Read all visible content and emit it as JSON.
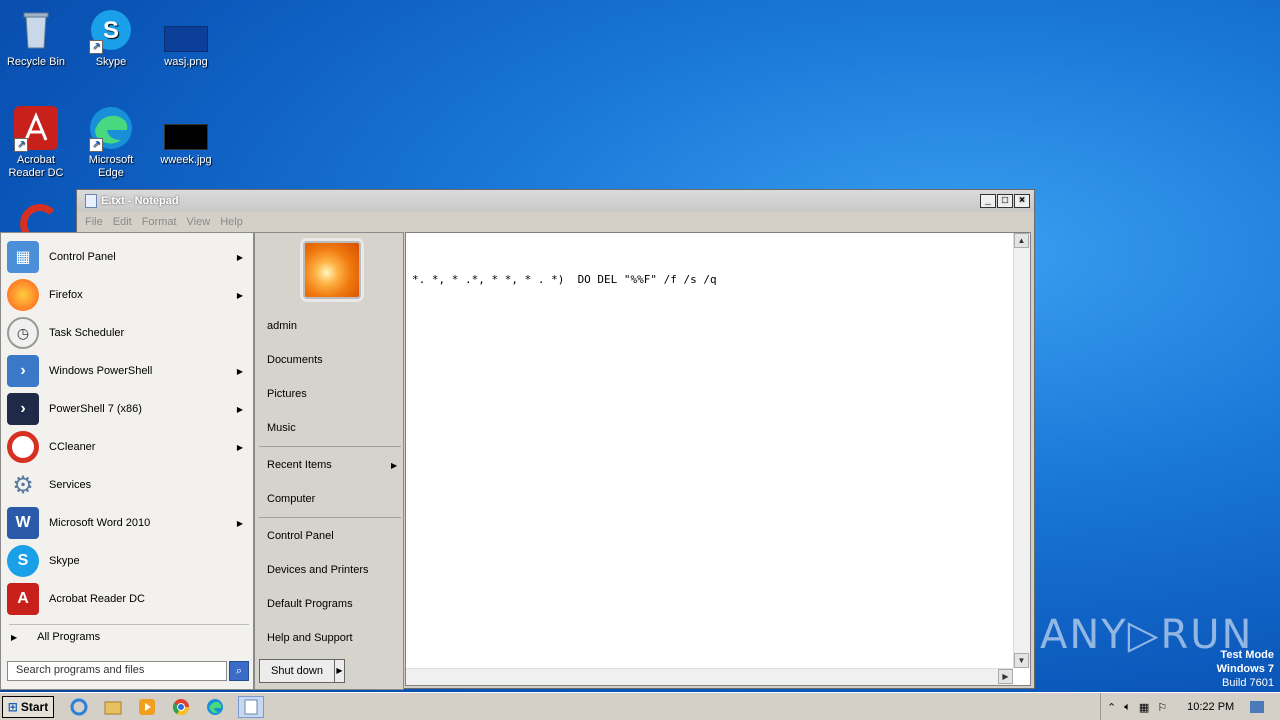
{
  "desktop": {
    "icons": [
      {
        "label": "Recycle Bin"
      },
      {
        "label": "Skype"
      },
      {
        "label": "wasj.png"
      },
      {
        "label": "Acrobat Reader DC"
      },
      {
        "label": "Microsoft Edge"
      },
      {
        "label": "wweek.jpg"
      }
    ]
  },
  "notepad": {
    "title": "E.txt - Notepad",
    "menu": [
      "File",
      "Edit",
      "Format",
      "View",
      "Help"
    ],
    "content": "*. *, * .*, * *, * . *)  DO DEL \"%%F\" /f /s /q",
    "controls": {
      "minimize": "_",
      "maximize": "□",
      "close": "×"
    }
  },
  "start_menu": {
    "programs": [
      {
        "label": "Control Panel",
        "submenu": true,
        "color": "#4a8fd8"
      },
      {
        "label": "Firefox",
        "submenu": true,
        "color": "#ff7a1a"
      },
      {
        "label": "Task Scheduler",
        "submenu": false,
        "color": "#b8b8b8"
      },
      {
        "label": "Windows PowerShell",
        "submenu": true,
        "color": "#3a78c8"
      },
      {
        "label": "PowerShell 7 (x86)",
        "submenu": true,
        "color": "#1e2a48"
      },
      {
        "label": "CCleaner",
        "submenu": true,
        "color": "#d83020"
      },
      {
        "label": "Services",
        "submenu": false,
        "color": "#8aa0b8"
      },
      {
        "label": "Microsoft Word 2010",
        "submenu": true,
        "color": "#2a5aa8"
      },
      {
        "label": "Skype",
        "submenu": false,
        "color": "#1aa0e8"
      },
      {
        "label": "Acrobat Reader DC",
        "submenu": false,
        "color": "#c8201a"
      }
    ],
    "all_programs": "All Programs",
    "search_placeholder": "Search programs and files",
    "right": {
      "user": "admin",
      "group1": [
        "Documents",
        "Pictures",
        "Music"
      ],
      "group2": [
        "Recent Items",
        "Computer"
      ],
      "group3": [
        "Control Panel",
        "Devices and Printers",
        "Default Programs",
        "Help and Support"
      ]
    },
    "shutdown": "Shut down"
  },
  "taskbar": {
    "start": "Start",
    "clock": "10:22 PM"
  },
  "watermark": {
    "line1": "Test Mode",
    "line2": "Windows 7",
    "line3": "Build 7601",
    "brand": "ANY▷RUN"
  }
}
